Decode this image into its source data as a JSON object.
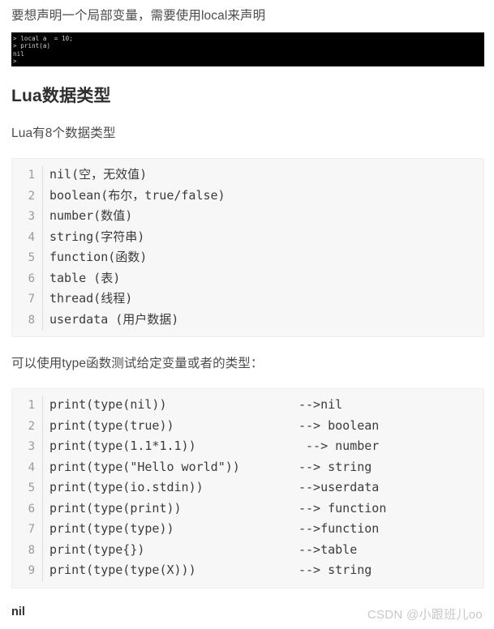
{
  "intro": {
    "text": "要想声明一个局部变量，需要使用local来声明"
  },
  "terminal": {
    "name": "lua-repl-screenshot",
    "lines": [
      "> local a  = 10;",
      "> print(a)",
      "nil",
      ">"
    ]
  },
  "section": {
    "heading": "Lua数据类型",
    "paragraph": "Lua有8个数据类型"
  },
  "code_block_types": {
    "lines": [
      {
        "n": "1",
        "code": "nil(空，无效值)"
      },
      {
        "n": "2",
        "code": "boolean(布尔，true/false)"
      },
      {
        "n": "3",
        "code": "number(数值)"
      },
      {
        "n": "4",
        "code": "string(字符串)"
      },
      {
        "n": "5",
        "code": "function(函数)"
      },
      {
        "n": "6",
        "code": "table (表)"
      },
      {
        "n": "7",
        "code": "thread(线程)"
      },
      {
        "n": "8",
        "code": "userdata (用户数据)"
      }
    ]
  },
  "mid_paragraph": {
    "text": "可以使用type函数测试给定变量或者的类型："
  },
  "code_block_type_fn": {
    "lines": [
      {
        "n": "1",
        "code": "print(type(nil))",
        "comment": "-->nil"
      },
      {
        "n": "2",
        "code": "print(type(true))",
        "comment": "--> boolean"
      },
      {
        "n": "3",
        "code": "print(type(1.1*1.1))",
        "comment": " --> number"
      },
      {
        "n": "4",
        "code": "print(type(\"Hello world\"))",
        "comment": "--> string"
      },
      {
        "n": "5",
        "code": "print(type(io.stdin))",
        "comment": "-->userdata"
      },
      {
        "n": "6",
        "code": "print(type(print))",
        "comment": "--> function"
      },
      {
        "n": "7",
        "code": "print(type(type))",
        "comment": "-->function"
      },
      {
        "n": "8",
        "code": "print(type{})",
        "comment": "-->table"
      },
      {
        "n": "9",
        "code": "print(type(type(X)))",
        "comment": "--> string"
      }
    ]
  },
  "footer": {
    "nil_text": "nil",
    "watermark": "CSDN @小跟班儿oo"
  },
  "colors": {
    "page_background": "#ffffff",
    "code_background": "#f7f7f7",
    "code_border": "#eeeeee",
    "gutter_text": "#9a9a9a",
    "code_text": "#3b3b3b",
    "body_text": "#4d4d4d",
    "heading_text": "#2f2f2f",
    "terminal_background": "#000000",
    "terminal_text": "#d2d2d2",
    "watermark_text": "#c8c8c8"
  }
}
